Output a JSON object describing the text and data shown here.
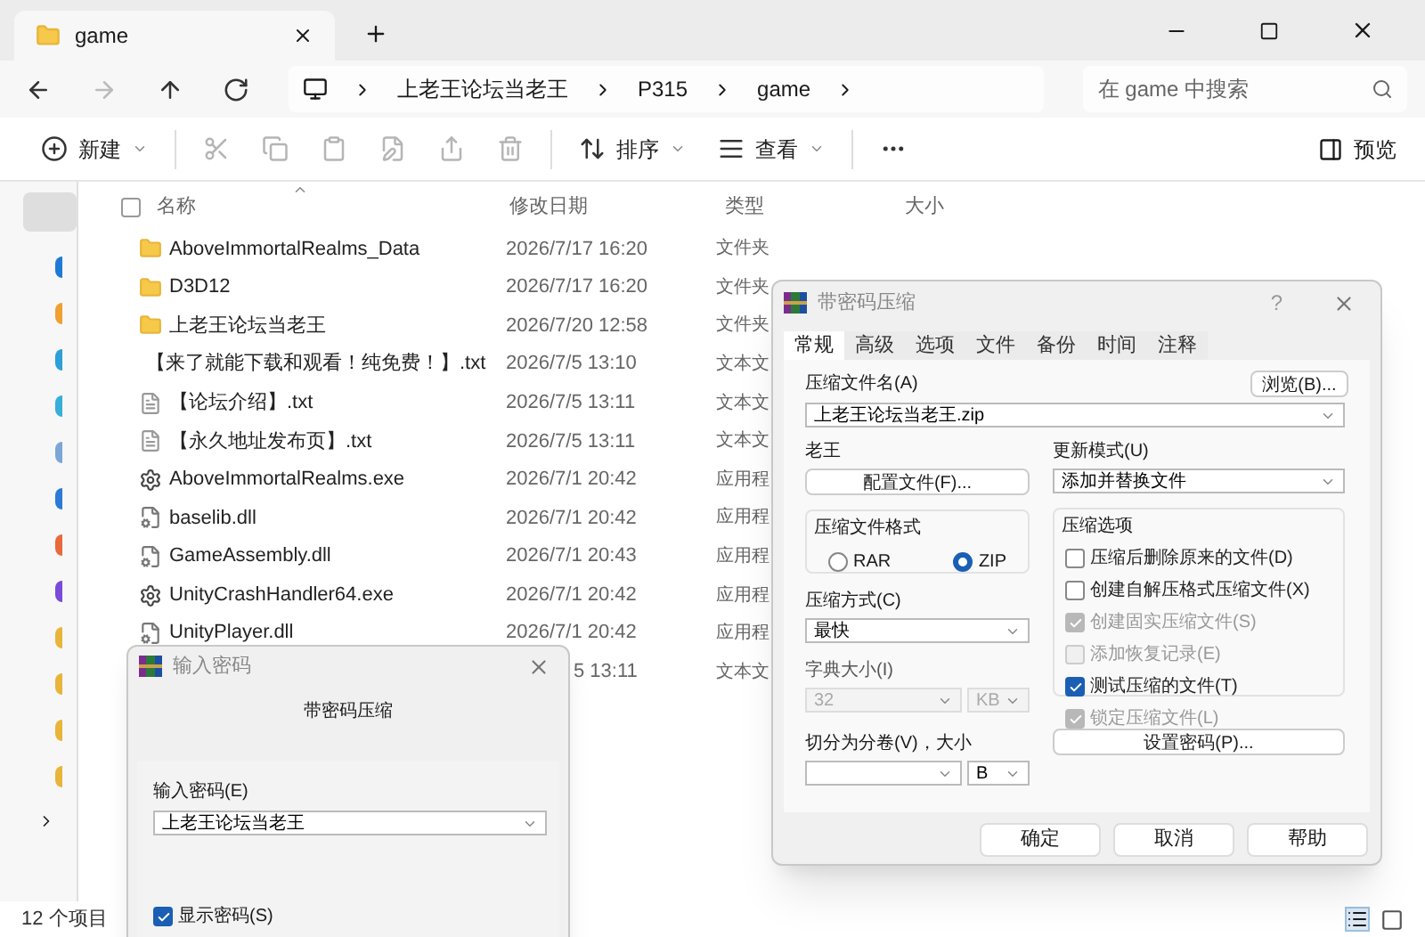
{
  "explorer": {
    "tab_title": "game",
    "nav_buttons": [
      {
        "kind": "back",
        "disabled": false
      },
      {
        "kind": "forward",
        "disabled": true
      },
      {
        "kind": "up",
        "disabled": false
      },
      {
        "kind": "refresh",
        "disabled": false
      }
    ],
    "breadcrumbs": [
      "上老王论坛当老王",
      "P315",
      "game"
    ],
    "search": {
      "placeholder": "在 game 中搜索"
    },
    "toolbar": [
      {
        "kind": "new",
        "label": "新建",
        "disabled": false
      },
      {
        "kind": "cut",
        "disabled": true
      },
      {
        "kind": "copy",
        "disabled": true
      },
      {
        "kind": "paste",
        "disabled": true
      },
      {
        "kind": "rename",
        "disabled": true
      },
      {
        "kind": "share",
        "disabled": true
      },
      {
        "kind": "delete",
        "disabled": true
      },
      {
        "kind": "sort",
        "label": "排序",
        "disabled": false
      },
      {
        "kind": "view",
        "label": "查看",
        "disabled": false
      },
      {
        "kind": "more",
        "disabled": false
      }
    ],
    "preview": "预览",
    "select_all_checked": false,
    "columns": [
      "名称",
      "修改日期",
      "类型",
      "大小"
    ],
    "rows": [
      {
        "kind": "folder",
        "name": "AboveImmortalRealms_Data",
        "date": "2026/7/17 16:20",
        "type": "文件夹"
      },
      {
        "kind": "folder",
        "name": "D3D12",
        "date": "2026/7/17 16:20",
        "type": "文件夹"
      },
      {
        "kind": "folder",
        "name": "上老王论坛当老王",
        "date": "2026/7/20 12:58",
        "type": "文件夹"
      },
      {
        "kind": "text",
        "name": "【来了就能下载和观看！纯免费！】.txt",
        "date": "2026/7/5 13:10",
        "type": "文本文"
      },
      {
        "kind": "text",
        "name": "【论坛介绍】.txt",
        "date": "2026/7/5 13:11",
        "type": "文本文"
      },
      {
        "kind": "text",
        "name": "【永久地址发布页】.txt",
        "date": "2026/7/5 13:11",
        "type": "文本文"
      },
      {
        "kind": "exe",
        "name": "AboveImmortalRealms.exe",
        "date": "2026/7/1 20:42",
        "type": "应用程"
      },
      {
        "kind": "dll",
        "name": "baselib.dll",
        "date": "2026/7/1 20:42",
        "type": "应用程"
      },
      {
        "kind": "dll",
        "name": "GameAssembly.dll",
        "date": "2026/7/1 20:43",
        "type": "应用程"
      },
      {
        "kind": "exe",
        "name": "UnityCrashHandler64.exe",
        "date": "2026/7/1 20:42",
        "type": "应用程"
      },
      {
        "kind": "dll",
        "name": "UnityPlayer.dll",
        "date": "2026/7/1 20:42",
        "type": "应用程"
      },
      {
        "kind": "hidden",
        "date": "5 13:11",
        "type": "文本文"
      }
    ],
    "status": "12 个项目"
  },
  "archive_dialog": {
    "title": "带密码压缩",
    "help": "?",
    "tabs": [
      {
        "label": "常规",
        "selected": true
      },
      {
        "label": "高级",
        "selected": false
      },
      {
        "label": "选项",
        "selected": false
      },
      {
        "label": "文件",
        "selected": false
      },
      {
        "label": "备份",
        "selected": false
      },
      {
        "label": "时间",
        "selected": false
      },
      {
        "label": "注释",
        "selected": false
      }
    ],
    "archive_name_label": "压缩文件名(A)",
    "browse_button": "浏览(B)...",
    "archive_name": "上老王论坛当老王.zip",
    "profile_label": "老王",
    "profile_button": "配置文件(F)...",
    "update_mode_label": "更新模式(U)",
    "update_mode": "添加并替换文件",
    "format_label": "压缩文件格式",
    "formats": [
      {
        "label": "RAR",
        "selected": false
      },
      {
        "label": "ZIP",
        "selected": true
      }
    ],
    "method_label": "压缩方式(C)",
    "method": "最快",
    "dict_label": "字典大小(I)",
    "dict_size": {
      "value": "32",
      "disabled": true
    },
    "dict_unit": {
      "value": "KB",
      "disabled": true
    },
    "split_label": "切分为分卷(V)，大小",
    "split_unit": "B",
    "options_label": "压缩选项",
    "options": [
      {
        "label": "压缩后删除原来的文件(D)",
        "checked": false,
        "disabled": false
      },
      {
        "label": "创建自解压格式压缩文件(X)",
        "checked": false,
        "disabled": false
      },
      {
        "label": "创建固实压缩文件(S)",
        "checked": true,
        "disabled": true
      },
      {
        "label": "添加恢复记录(E)",
        "checked": false,
        "disabled": true
      },
      {
        "label": "测试压缩的文件(T)",
        "checked": true,
        "disabled": false
      },
      {
        "label": "锁定压缩文件(L)",
        "checked": true,
        "disabled": true
      }
    ],
    "password_button": "设置密码(P)...",
    "buttons": [
      "确定",
      "取消",
      "帮助"
    ]
  },
  "password_dialog": {
    "title": "输入密码",
    "heading": "带密码压缩",
    "field_label": "输入密码(E)",
    "password": "上老王论坛当老王",
    "show_password": {
      "label": "显示密码(S)",
      "checked": true
    }
  }
}
